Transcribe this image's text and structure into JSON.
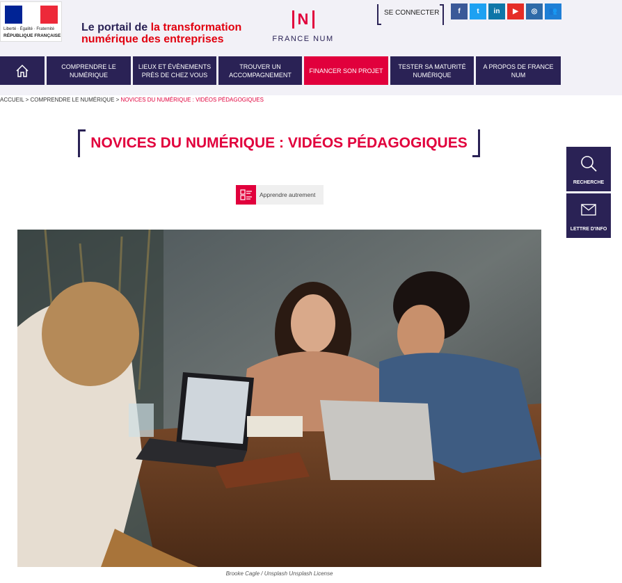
{
  "gov": {
    "line1": "Liberté · Égalité · Fraternité",
    "line2": "RÉPUBLIQUE FRANÇAISE",
    "colors": [
      "#002395",
      "#ffffff",
      "#ed2939"
    ]
  },
  "header": {
    "tagline_plain": "Le portail de ",
    "tagline_accent_1": "la transformation",
    "tagline_accent_2": "numérique des entreprises",
    "logo_mark": "N",
    "logo_text": "FRANCE NUM",
    "connect_label": "SE CONNECTER"
  },
  "social": [
    {
      "name": "facebook-icon",
      "glyph": "f",
      "color": "#3b5998"
    },
    {
      "name": "twitter-icon",
      "glyph": "t",
      "color": "#1da1f2"
    },
    {
      "name": "linkedin-icon",
      "glyph": "in",
      "color": "#0e76a8"
    },
    {
      "name": "youtube-icon",
      "glyph": "▶",
      "color": "#e52d27"
    },
    {
      "name": "instagram-icon",
      "glyph": "◎",
      "color": "#2e6aa8"
    },
    {
      "name": "community-icon",
      "glyph": "👥",
      "color": "#1f7fd6"
    }
  ],
  "nav": {
    "home_icon": "home-icon",
    "items": [
      {
        "label": "COMPRENDRE LE NUMÉRIQUE",
        "active": false
      },
      {
        "label": "LIEUX ET ÉVÈNEMENTS PRÈS DE CHEZ VOUS",
        "active": false
      },
      {
        "label": "TROUVER UN ACCOMPAGNEMENT",
        "active": false
      },
      {
        "label": "FINANCER SON PROJET",
        "active": true
      },
      {
        "label": "TESTER SA MATURITÉ NUMÉRIQUE",
        "active": false
      },
      {
        "label": "A PROPOS DE FRANCE NUM",
        "active": false
      }
    ]
  },
  "breadcrumb": {
    "home": "ACCUEIL",
    "sep": " > ",
    "section": "COMPRENDRE LE NUMÉRIQUE",
    "current": "NOVICES DU NUMÉRIQUE : VIDÉOS PÉDAGOGIQUES"
  },
  "page": {
    "title": "NOVICES DU NUMÉRIQUE : VIDÉOS PÉDAGOGIQUES",
    "tag_label": "Apprendre autrement",
    "credit": "Brooke Cagle / Unsplash Unsplash License"
  },
  "sidebar": {
    "search_label": "RECHERCHE",
    "newsletter_label": "LETTRE D'INFO"
  },
  "colors": {
    "navy": "#2a2255",
    "accent": "#e1003c"
  }
}
